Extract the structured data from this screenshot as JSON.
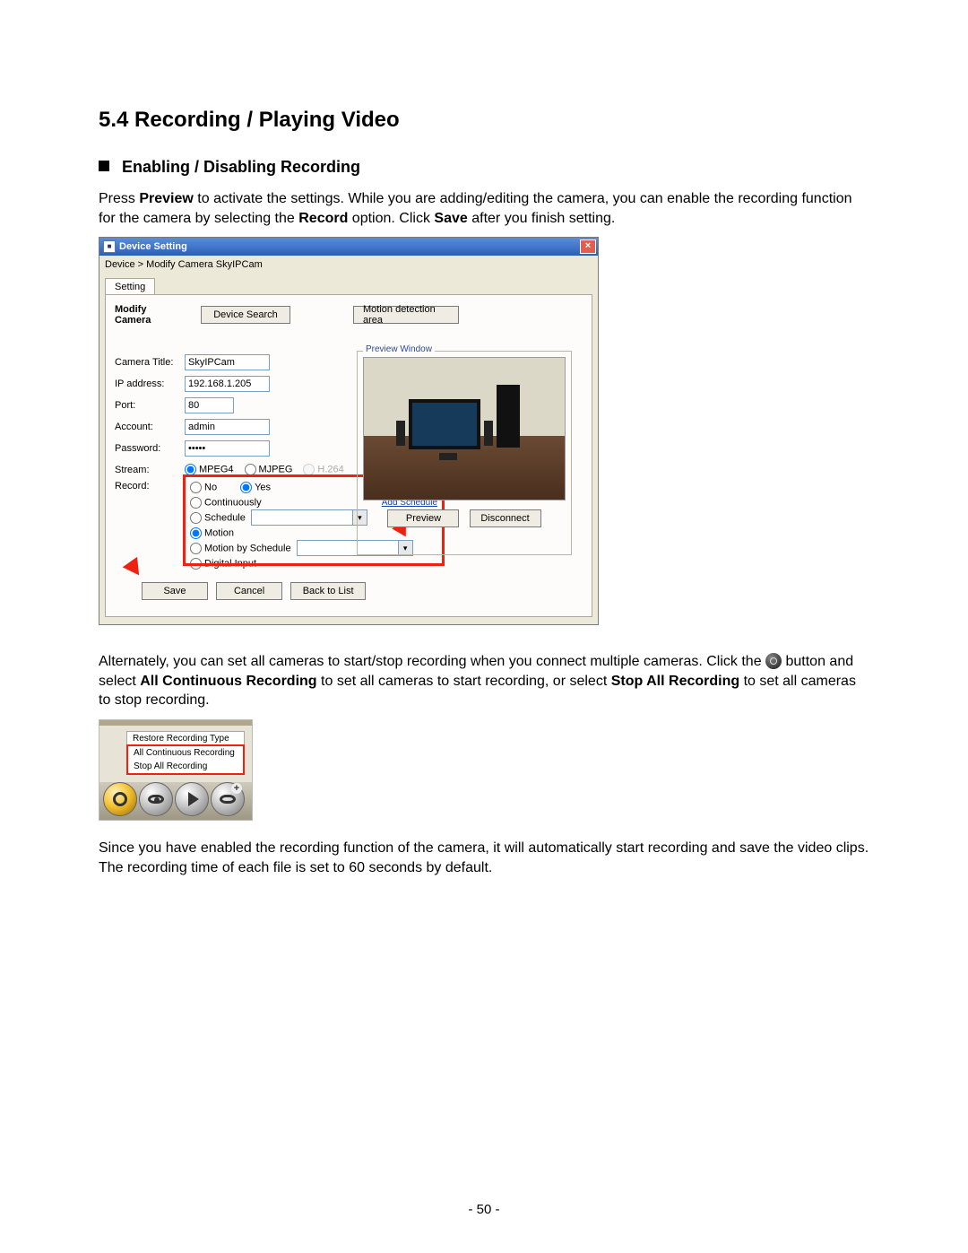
{
  "section": {
    "number_title": "5.4  Recording / Playing Video",
    "sub_title": "Enabling / Disabling Recording",
    "para1_a": "Press ",
    "para1_preview": "Preview",
    "para1_b": " to activate the settings. While you are adding/editing the camera, you can enable the recording function for the camera by selecting the ",
    "para1_record": "Record",
    "para1_c": " option. Click ",
    "para1_save": "Save",
    "para1_d": " after you finish setting.",
    "para2_a": "Alternately, you can set all cameras to start/stop recording when you connect multiple cameras. Click the ",
    "para2_b": " button and select ",
    "para2_allcont": "All Continuous Recording",
    "para2_c": " to set all cameras to start recording, or select ",
    "para2_stopall": "Stop All Recording",
    "para2_d": " to set all cameras to stop recording.",
    "para3": "Since you have enabled the recording function of the camera, it will automatically start recording and save the video clips. The recording time of each file is set to 60 seconds by default."
  },
  "dialog": {
    "title": "Device Setting",
    "breadcrumb": "Device > Modify Camera SkyIPCam",
    "tab": "Setting",
    "modify_camera_label": "Modify Camera",
    "device_search_btn": "Device Search",
    "motion_area_btn": "Motion detection area",
    "labels": {
      "camera_title": "Camera Title:",
      "ip": "IP address:",
      "port": "Port:",
      "account": "Account:",
      "password": "Password:",
      "stream": "Stream:",
      "record": "Record:"
    },
    "values": {
      "camera_title": "SkyIPCam",
      "ip": "192.168.1.205",
      "port": "80",
      "account": "admin",
      "password": "*****"
    },
    "stream_options": {
      "mpeg4": "MPEG4",
      "mjpeg": "MJPEG",
      "h264": "H.264"
    },
    "record_options": {
      "no": "No",
      "yes": "Yes",
      "continuously": "Continuously",
      "schedule": "Schedule",
      "motion": "Motion",
      "motion_by_schedule": "Motion by Schedule",
      "digital_input": "Digital Input",
      "add_schedule": "Add Schedule"
    },
    "preview_group_legend": "Preview Window",
    "preview_btn": "Preview",
    "disconnect_btn": "Disconnect",
    "save_btn": "Save",
    "cancel_btn": "Cancel",
    "back_btn": "Back to List"
  },
  "menu": {
    "restore": "Restore Recording Type",
    "all_continuous": "All Continuous Recording",
    "stop_all": "Stop All Recording"
  },
  "page_number": "- 50 -"
}
